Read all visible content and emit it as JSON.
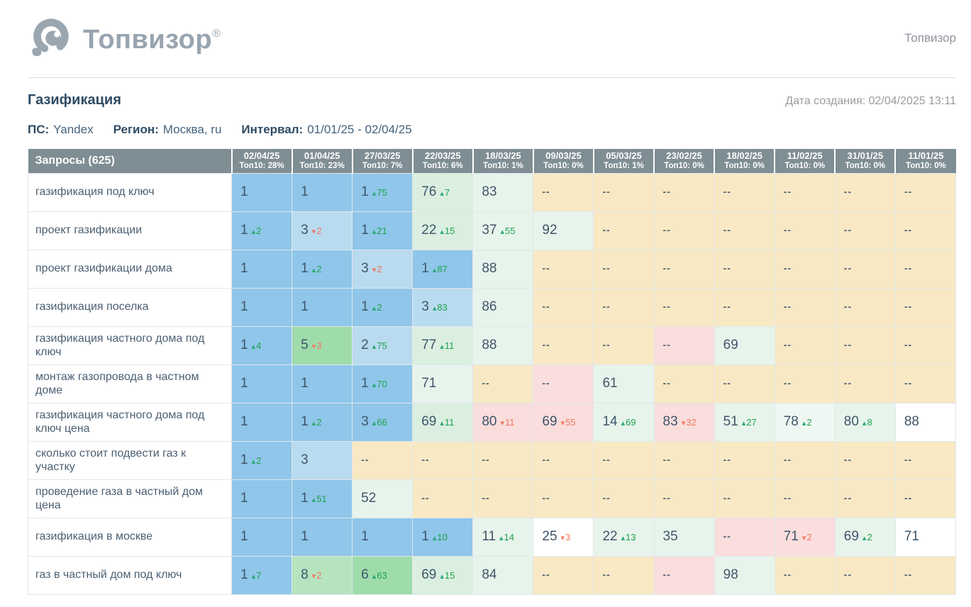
{
  "brand": {
    "logo_text": "Топвизор",
    "reg_mark": "®",
    "header_right": "Топвизор"
  },
  "report": {
    "title": "Газификация",
    "created": "Дата создания: 02/04/2025 13:11",
    "meta": [
      {
        "label": "ПС:",
        "value": "Yandex"
      },
      {
        "label": "Регион:",
        "value": "Москва, ru"
      },
      {
        "label": "Интервал:",
        "value": "01/01/25 - 02/04/25"
      }
    ]
  },
  "colors": {
    "header_bg": "#7f8e94",
    "up": "#1fa24a",
    "up_arrow": "#2aa876",
    "down": "#f0775f",
    "down_arrow": "#f0775f",
    "b": "#8fc6e9",
    "lb": "#b9dbf0",
    "g": "#9edcab",
    "lg": "#b5e4bf",
    "pg": "#daefe0",
    "m": "#e7f4ec",
    "pm": "#eef7f2",
    "be": "#f8e9c4",
    "p": "#fadddd",
    "w": "#ffffff"
  },
  "table": {
    "queries_header": "Запросы (625)",
    "columns": [
      {
        "date": "02/04/25",
        "top10": "Топ10: 28%"
      },
      {
        "date": "01/04/25",
        "top10": "Топ10: 23%"
      },
      {
        "date": "27/03/25",
        "top10": "Топ10: 7%"
      },
      {
        "date": "22/03/25",
        "top10": "Топ10: 6%"
      },
      {
        "date": "18/03/25",
        "top10": "Топ10: 1%"
      },
      {
        "date": "09/03/25",
        "top10": "Топ10: 0%"
      },
      {
        "date": "05/03/25",
        "top10": "Топ10: 1%"
      },
      {
        "date": "23/02/25",
        "top10": "Топ10: 0%"
      },
      {
        "date": "18/02/25",
        "top10": "Топ10: 0%"
      },
      {
        "date": "11/02/25",
        "top10": "Топ10: 0%"
      },
      {
        "date": "31/01/25",
        "top10": "Топ10: 0%"
      },
      {
        "date": "11/01/25",
        "top10": "Топ10: 0%"
      }
    ],
    "rows": [
      {
        "query": "газификация под ключ",
        "cells": [
          {
            "v": "1",
            "bg": "b"
          },
          {
            "v": "1",
            "bg": "b"
          },
          {
            "v": "1",
            "chg": "75",
            "dir": "up",
            "bg": "b"
          },
          {
            "v": "76",
            "chg": "7",
            "dir": "up",
            "bg": "pg"
          },
          {
            "v": "83",
            "bg": "m"
          },
          {
            "v": "--",
            "bg": "be"
          },
          {
            "v": "--",
            "bg": "be"
          },
          {
            "v": "--",
            "bg": "be"
          },
          {
            "v": "--",
            "bg": "be"
          },
          {
            "v": "--",
            "bg": "be"
          },
          {
            "v": "--",
            "bg": "be"
          },
          {
            "v": "--",
            "bg": "be"
          }
        ]
      },
      {
        "query": "проект газификации",
        "cells": [
          {
            "v": "1",
            "chg": "2",
            "dir": "up",
            "bg": "b"
          },
          {
            "v": "3",
            "chg": "2",
            "dir": "down",
            "bg": "lb"
          },
          {
            "v": "1",
            "chg": "21",
            "dir": "up",
            "bg": "b"
          },
          {
            "v": "22",
            "chg": "15",
            "dir": "up",
            "bg": "pg"
          },
          {
            "v": "37",
            "chg": "55",
            "dir": "up",
            "bg": "m"
          },
          {
            "v": "92",
            "bg": "m"
          },
          {
            "v": "--",
            "bg": "be"
          },
          {
            "v": "--",
            "bg": "be"
          },
          {
            "v": "--",
            "bg": "be"
          },
          {
            "v": "--",
            "bg": "be"
          },
          {
            "v": "--",
            "bg": "be"
          },
          {
            "v": "--",
            "bg": "be"
          }
        ]
      },
      {
        "query": "проект газификации дома",
        "cells": [
          {
            "v": "1",
            "bg": "b"
          },
          {
            "v": "1",
            "chg": "2",
            "dir": "up",
            "bg": "b"
          },
          {
            "v": "3",
            "chg": "2",
            "dir": "down",
            "bg": "lb"
          },
          {
            "v": "1",
            "chg": "87",
            "dir": "up",
            "bg": "b"
          },
          {
            "v": "88",
            "bg": "m"
          },
          {
            "v": "--",
            "bg": "be"
          },
          {
            "v": "--",
            "bg": "be"
          },
          {
            "v": "--",
            "bg": "be"
          },
          {
            "v": "--",
            "bg": "be"
          },
          {
            "v": "--",
            "bg": "be"
          },
          {
            "v": "--",
            "bg": "be"
          },
          {
            "v": "--",
            "bg": "be"
          }
        ]
      },
      {
        "query": "газификация поселка",
        "cells": [
          {
            "v": "1",
            "bg": "b"
          },
          {
            "v": "1",
            "bg": "b"
          },
          {
            "v": "1",
            "chg": "2",
            "dir": "up",
            "bg": "b"
          },
          {
            "v": "3",
            "chg": "83",
            "dir": "up",
            "bg": "lb"
          },
          {
            "v": "86",
            "bg": "m"
          },
          {
            "v": "--",
            "bg": "be"
          },
          {
            "v": "--",
            "bg": "be"
          },
          {
            "v": "--",
            "bg": "be"
          },
          {
            "v": "--",
            "bg": "be"
          },
          {
            "v": "--",
            "bg": "be"
          },
          {
            "v": "--",
            "bg": "be"
          },
          {
            "v": "--",
            "bg": "be"
          }
        ]
      },
      {
        "query": "газификация частного дома под ключ",
        "cells": [
          {
            "v": "1",
            "chg": "4",
            "dir": "up",
            "bg": "b"
          },
          {
            "v": "5",
            "chg": "3",
            "dir": "down",
            "bg": "g"
          },
          {
            "v": "2",
            "chg": "75",
            "dir": "up",
            "bg": "lb"
          },
          {
            "v": "77",
            "chg": "11",
            "dir": "up",
            "bg": "pg"
          },
          {
            "v": "88",
            "bg": "m"
          },
          {
            "v": "--",
            "bg": "be"
          },
          {
            "v": "--",
            "bg": "be"
          },
          {
            "v": "--",
            "bg": "p"
          },
          {
            "v": "69",
            "bg": "m"
          },
          {
            "v": "--",
            "bg": "be"
          },
          {
            "v": "--",
            "bg": "be"
          },
          {
            "v": "--",
            "bg": "be"
          }
        ]
      },
      {
        "query": "монтаж газопровода в частном доме",
        "cells": [
          {
            "v": "1",
            "bg": "b"
          },
          {
            "v": "1",
            "bg": "b"
          },
          {
            "v": "1",
            "chg": "70",
            "dir": "up",
            "bg": "b"
          },
          {
            "v": "71",
            "bg": "m"
          },
          {
            "v": "--",
            "bg": "be"
          },
          {
            "v": "--",
            "bg": "p"
          },
          {
            "v": "61",
            "bg": "m"
          },
          {
            "v": "--",
            "bg": "be"
          },
          {
            "v": "--",
            "bg": "be"
          },
          {
            "v": "--",
            "bg": "be"
          },
          {
            "v": "--",
            "bg": "be"
          },
          {
            "v": "--",
            "bg": "be"
          }
        ]
      },
      {
        "query": "газификация частного дома под ключ цена",
        "cells": [
          {
            "v": "1",
            "bg": "b"
          },
          {
            "v": "1",
            "chg": "2",
            "dir": "up",
            "bg": "b"
          },
          {
            "v": "3",
            "chg": "66",
            "dir": "up",
            "bg": "b"
          },
          {
            "v": "69",
            "chg": "11",
            "dir": "up",
            "bg": "pg"
          },
          {
            "v": "80",
            "chg": "11",
            "dir": "down",
            "bg": "p"
          },
          {
            "v": "69",
            "chg": "55",
            "dir": "down",
            "bg": "p"
          },
          {
            "v": "14",
            "chg": "69",
            "dir": "up",
            "bg": "m"
          },
          {
            "v": "83",
            "chg": "32",
            "dir": "down",
            "bg": "p"
          },
          {
            "v": "51",
            "chg": "27",
            "dir": "up",
            "bg": "m"
          },
          {
            "v": "78",
            "chg": "2",
            "dir": "up",
            "bg": "pm"
          },
          {
            "v": "80",
            "chg": "8",
            "dir": "up",
            "bg": "m"
          },
          {
            "v": "88",
            "bg": "w"
          }
        ]
      },
      {
        "query": "сколько стоит подвести газ к участку",
        "cells": [
          {
            "v": "1",
            "chg": "2",
            "dir": "up",
            "bg": "b"
          },
          {
            "v": "3",
            "bg": "lb"
          },
          {
            "v": "--",
            "bg": "be"
          },
          {
            "v": "--",
            "bg": "be"
          },
          {
            "v": "--",
            "bg": "be"
          },
          {
            "v": "--",
            "bg": "be"
          },
          {
            "v": "--",
            "bg": "be"
          },
          {
            "v": "--",
            "bg": "be"
          },
          {
            "v": "--",
            "bg": "be"
          },
          {
            "v": "--",
            "bg": "be"
          },
          {
            "v": "--",
            "bg": "be"
          },
          {
            "v": "--",
            "bg": "be"
          }
        ]
      },
      {
        "query": "проведение газа в частный дом цена",
        "cells": [
          {
            "v": "1",
            "bg": "b"
          },
          {
            "v": "1",
            "chg": "51",
            "dir": "up",
            "bg": "b"
          },
          {
            "v": "52",
            "bg": "m"
          },
          {
            "v": "--",
            "bg": "be"
          },
          {
            "v": "--",
            "bg": "be"
          },
          {
            "v": "--",
            "bg": "be"
          },
          {
            "v": "--",
            "bg": "be"
          },
          {
            "v": "--",
            "bg": "be"
          },
          {
            "v": "--",
            "bg": "be"
          },
          {
            "v": "--",
            "bg": "be"
          },
          {
            "v": "--",
            "bg": "be"
          },
          {
            "v": "--",
            "bg": "be"
          }
        ]
      },
      {
        "query": "газификация в москве",
        "cells": [
          {
            "v": "1",
            "bg": "b"
          },
          {
            "v": "1",
            "bg": "b"
          },
          {
            "v": "1",
            "bg": "b"
          },
          {
            "v": "1",
            "chg": "10",
            "dir": "up",
            "bg": "b"
          },
          {
            "v": "11",
            "chg": "14",
            "dir": "up",
            "bg": "m"
          },
          {
            "v": "25",
            "chg": "3",
            "dir": "down",
            "bg": "w"
          },
          {
            "v": "22",
            "chg": "13",
            "dir": "up",
            "bg": "m"
          },
          {
            "v": "35",
            "bg": "m"
          },
          {
            "v": "--",
            "bg": "p"
          },
          {
            "v": "71",
            "chg": "2",
            "dir": "down",
            "bg": "p"
          },
          {
            "v": "69",
            "chg": "2",
            "dir": "up",
            "bg": "m"
          },
          {
            "v": "71",
            "bg": "w"
          }
        ]
      },
      {
        "query": "газ в частный дом под ключ",
        "cells": [
          {
            "v": "1",
            "chg": "7",
            "dir": "up",
            "bg": "b"
          },
          {
            "v": "8",
            "chg": "2",
            "dir": "down",
            "bg": "lg"
          },
          {
            "v": "6",
            "chg": "63",
            "dir": "up",
            "bg": "g"
          },
          {
            "v": "69",
            "chg": "15",
            "dir": "up",
            "bg": "pg"
          },
          {
            "v": "84",
            "bg": "m"
          },
          {
            "v": "--",
            "bg": "be"
          },
          {
            "v": "--",
            "bg": "be"
          },
          {
            "v": "--",
            "bg": "p"
          },
          {
            "v": "98",
            "bg": "m"
          },
          {
            "v": "--",
            "bg": "be"
          },
          {
            "v": "--",
            "bg": "be"
          },
          {
            "v": "--",
            "bg": "be"
          }
        ]
      }
    ]
  }
}
